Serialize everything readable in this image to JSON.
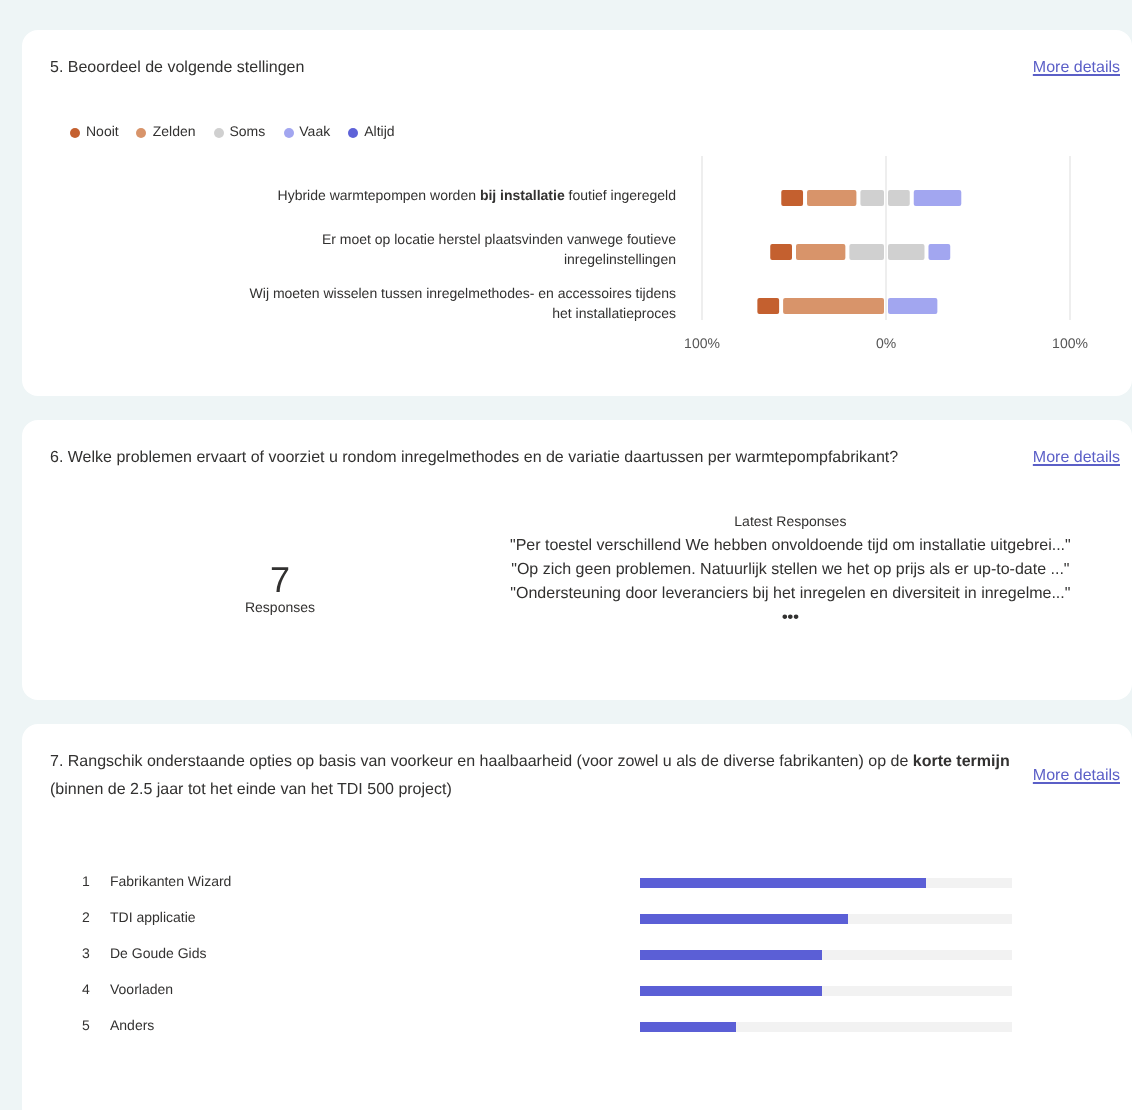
{
  "cards": [
    {
      "kind": "likert",
      "title": "5. Beoordeel de volgende stellingen",
      "link": "More details",
      "chart_data": {
        "type": "bar",
        "orientation": "horizontal",
        "stacked": true,
        "categories": [
          "Hybride warmtepompen worden **bij installatie** foutief ingeregeld",
          "Er moet op locatie herstel plaatsvinden vanwege foutieve inregelinstellingen",
          "Wij moeten wisselen tussen inregelmethodes- en accessoires tijdens het installatieproces"
        ],
        "series": [
          {
            "name": "Soms",
            "color": "#d0d0d0",
            "values": [
              -15,
              -21,
              0
            ]
          },
          {
            "name": "Zelden",
            "color": "#d8946a",
            "values": [
              -29,
              -29,
              -57
            ]
          },
          {
            "name": "Nooit",
            "color": "#c4602f",
            "values": [
              -14,
              -14,
              -14
            ]
          },
          {
            "color": "#d0d0d0",
            "values": [
              14,
              22,
              0
            ]
          },
          {
            "name": "Vaak",
            "color": "#a2a6f0",
            "values": [
              28,
              14,
              29
            ]
          },
          {
            "name": "Altijd",
            "color": "#5e62d8",
            "values": [
              0,
              0,
              0
            ]
          }
        ],
        "xlim": [
          -100,
          100
        ],
        "xticks": [
          {
            "value": -100,
            "label": "100%"
          },
          {
            "value": 0,
            "label": "0%"
          },
          {
            "value": 100,
            "label": "100%"
          }
        ]
      }
    },
    {
      "kind": "text",
      "title": "6. Welke problemen ervaart of voorziet u rondom inregelmethodes en de variatie daartussen per warmtepompfabrikant?",
      "link": "More details",
      "count": "7",
      "count_label": "Responses",
      "latest_label": "Latest Responses",
      "responses": [
        "\"Per toestel verschillend We hebben onvoldoende tijd om installatie uitgebrei...\"",
        "\"Op zich geen problemen. Natuurlijk stellen we het op prijs als er up-to-date ...\"",
        "\"Ondersteuning door leveranciers bij het inregelen en diversiteit in inregelme...\""
      ],
      "more": "•••"
    },
    {
      "kind": "ranking",
      "title": "7. Rangschik onderstaande opties op basis van voorkeur en haalbaarheid (voor zowel u als de diverse fabrikanten) op de **korte termijn** (binnen de 2.5 jaar tot het einde van het TDI 500 project)",
      "link": "More details",
      "items": [
        {
          "rank": "1",
          "label": "Fabrikanten Wizard",
          "level": 0.77
        },
        {
          "rank": "2",
          "label": "TDI applicatie",
          "level": 0.56
        },
        {
          "rank": "3",
          "label": "De Goude Gids",
          "level": 0.49
        },
        {
          "rank": "4",
          "label": "Voorladen",
          "level": 0.49
        },
        {
          "rank": "5",
          "label": "Anders",
          "level": 0.26
        }
      ]
    }
  ]
}
